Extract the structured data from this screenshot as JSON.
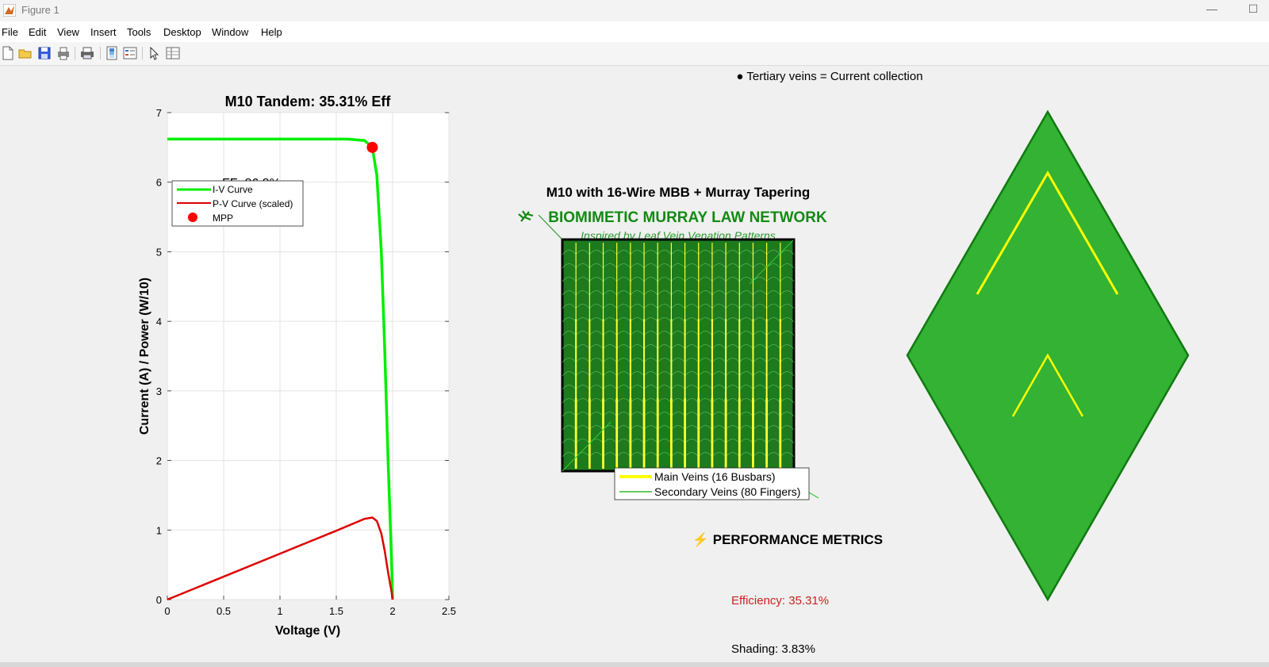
{
  "window": {
    "title": "Figure 1"
  },
  "menu": [
    "File",
    "Edit",
    "View",
    "Insert",
    "Tools",
    "Desktop",
    "Window",
    "Help"
  ],
  "toolbar": [
    "new-figure-icon",
    "open-file-icon",
    "save-icon",
    "print-icon",
    "print-preview-icon",
    "colorbar-icon",
    "legend-icon",
    "pointer-icon",
    "property-editor-icon"
  ],
  "iv_plot": {
    "title": "M10 Tandem: 35.31% Eff",
    "xlabel": "Voltage (V)",
    "ylabel": "Current (A) / Power (W/10)",
    "xticks": [
      "0",
      "0.5",
      "1",
      "1.5",
      "2",
      "2.5"
    ],
    "yticks": [
      "0",
      "1",
      "2",
      "3",
      "4",
      "5",
      "6",
      "7"
    ],
    "legend": [
      "I-V Curve",
      "P-V Curve (scaled)",
      "MPP"
    ],
    "ff_label": "FF: 86.8%"
  },
  "chart_data": {
    "type": "line",
    "title": "M10 Tandem: 35.31% Eff",
    "xlabel": "Voltage (V)",
    "ylabel": "Current (A) / Power (W/10)",
    "xlim": [
      0,
      2.5
    ],
    "ylim": [
      0,
      7
    ],
    "grid": true,
    "legend_position": "top-left",
    "series": [
      {
        "name": "I-V Curve",
        "color": "#00ee00",
        "x": [
          0,
          1.0,
          1.6,
          1.75,
          1.82,
          1.86,
          1.9,
          1.93,
          1.96,
          1.99,
          2.0
        ],
        "y": [
          6.62,
          6.62,
          6.62,
          6.6,
          6.5,
          6.1,
          5.0,
          3.6,
          2.0,
          0.6,
          0
        ]
      },
      {
        "name": "P-V Curve (scaled)",
        "color": "#dd0000",
        "x": [
          0,
          0.5,
          1.0,
          1.5,
          1.75,
          1.82,
          1.86,
          1.9,
          1.93,
          1.96,
          1.99,
          2.0
        ],
        "y": [
          0,
          0.33,
          0.66,
          0.99,
          1.16,
          1.18,
          1.13,
          0.95,
          0.7,
          0.39,
          0.12,
          0
        ]
      },
      {
        "name": "MPP",
        "color": "#ff0000",
        "x": [
          1.82
        ],
        "y": [
          6.5
        ]
      }
    ]
  },
  "network": {
    "main_title": "M10 with 16-Wire MBB + Murray Tapering",
    "subtitle": "BIOMIMETIC MURRAY LAW NETWORK",
    "subtitle_icon": "leaf-icon",
    "inspired": "Inspired by Leaf Vein Venation Patterns",
    "legend": [
      "Main Veins (16 Busbars)",
      "Secondary Veins (80 Fingers)"
    ],
    "tertiary": "● Tertiary veins = Current collection",
    "performance_header": "⚡ PERFORMANCE METRICS",
    "efficiency": "Efficiency: 35.31%",
    "shading": "Shading: 3.83%"
  },
  "colors": {
    "iv": "#00ee00",
    "pv": "#dd0000",
    "mpp": "#ff0000",
    "leaf": "#33b233",
    "vein": "#ffff00",
    "cell": "#1d7a1d",
    "title_green": "#128a12",
    "efficiency_red": "#cc1f1f"
  }
}
